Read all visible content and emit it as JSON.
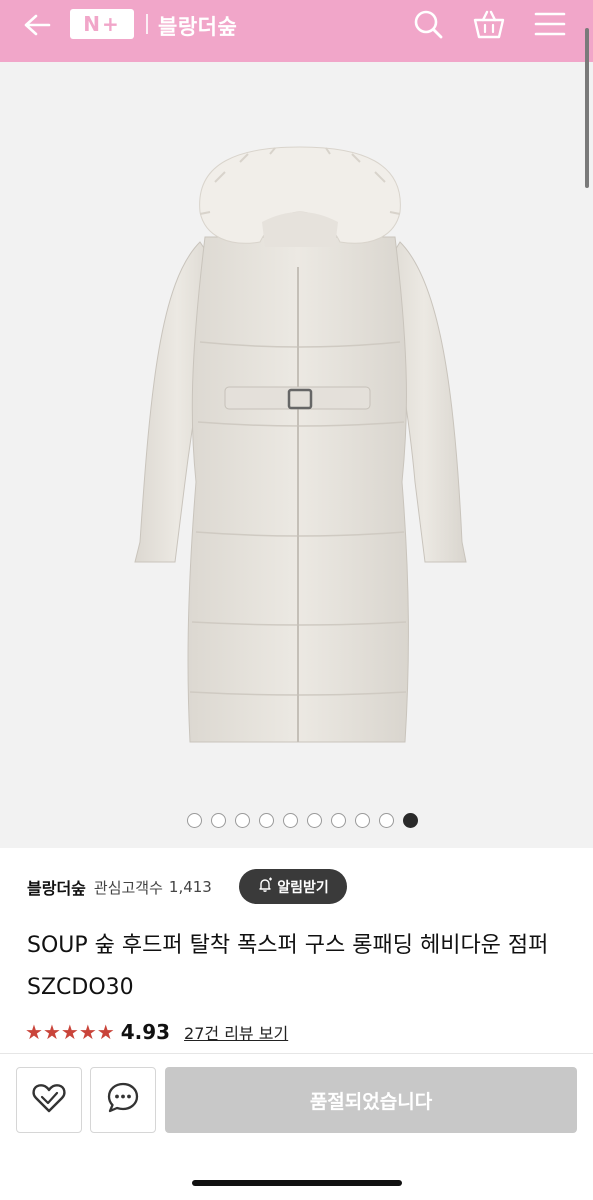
{
  "header": {
    "logo_text": "N+",
    "store_title": "블랑더숲",
    "icons": [
      "back-arrow-icon",
      "search-icon",
      "shopping-bag-icon",
      "menu-icon"
    ],
    "bg_color": "#f1a6c9"
  },
  "product_image": {
    "dots_total": 10,
    "active_index": 9
  },
  "store": {
    "name": "블랑더숲",
    "follower_label": "관심고객수",
    "follower_count": "1,413",
    "notify_label": "알림받기"
  },
  "product": {
    "title": "SOUP 숲 후드퍼 탈착 폭스퍼 구스 롱패딩 헤비다운 점퍼 SZCDO30",
    "rating": "4.93",
    "stars": 5,
    "review_link": "27건 리뷰 보기",
    "star_color": "#c9443a"
  },
  "bottom_bar": {
    "soldout_label": "품절되었습니다",
    "icons": [
      "heart-icon",
      "chat-bubble-icon"
    ]
  }
}
